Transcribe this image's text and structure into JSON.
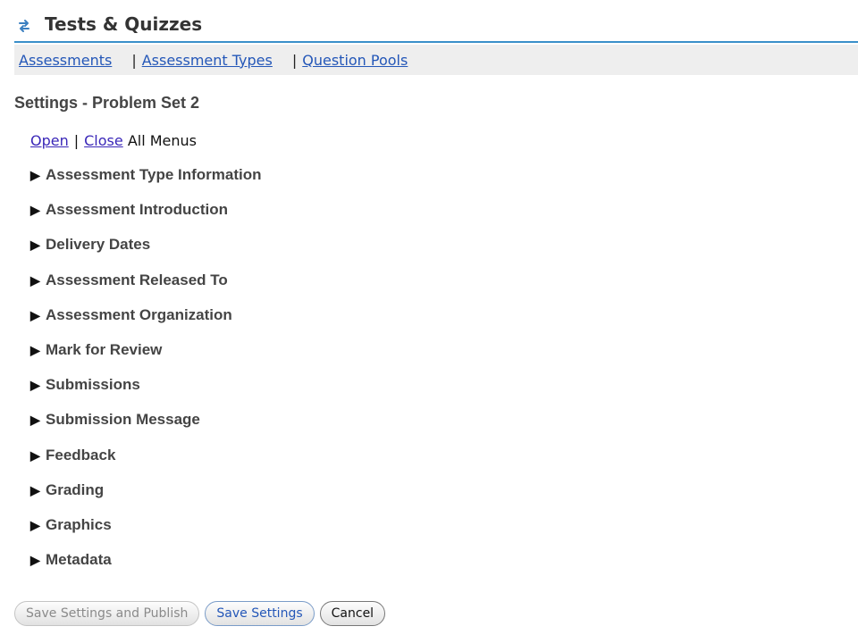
{
  "header": {
    "title": "Tests & Quizzes",
    "icon": "reload-arrows-icon"
  },
  "nav": {
    "links": [
      "Assessments",
      "Assessment Types",
      "Question Pools"
    ],
    "separator": "|"
  },
  "page_title": "Settings - Problem Set 2",
  "menu_controls": {
    "open_label": "Open",
    "separator": "|",
    "close_label": "Close",
    "suffix": "All Menus"
  },
  "sections": [
    "Assessment Type Information",
    "Assessment Introduction",
    "Delivery Dates",
    "Assessment Released To",
    "Assessment Organization",
    "Mark for Review",
    "Submissions",
    "Submission Message",
    "Feedback",
    "Grading",
    "Graphics",
    "Metadata"
  ],
  "arrow_glyph": "▶",
  "buttons": {
    "save_publish": "Save Settings and Publish",
    "save": "Save Settings",
    "cancel": "Cancel"
  },
  "colors": {
    "accent_line": "#3a8fc9",
    "link": "#2457b8",
    "nav_background": "#eeeeee"
  }
}
